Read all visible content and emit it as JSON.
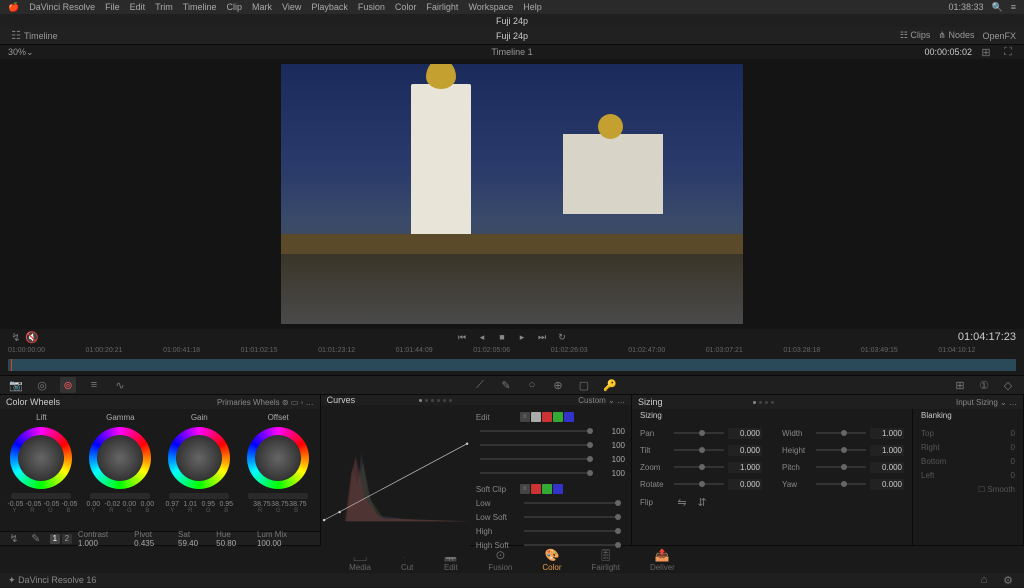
{
  "menubar": {
    "app": "DaVinci Resolve",
    "items": [
      "File",
      "Edit",
      "Trim",
      "Timeline",
      "Clip",
      "Mark",
      "View",
      "Playback",
      "Fusion",
      "Color",
      "Fairlight",
      "Workspace",
      "Help"
    ],
    "clock": "01:38:33"
  },
  "titlebar": {
    "title": "Fuji 24p"
  },
  "toolbar": {
    "left": "Timeline",
    "center": "Fuji 24p",
    "clips": "Clips",
    "nodes": "Nodes",
    "openfx": "OpenFX"
  },
  "subbar": {
    "zoom": "30%",
    "timeline": "Timeline 1",
    "timecode": "00:00:05:02"
  },
  "transport": {
    "left_tc": "",
    "right_tc": "01:04:17:23"
  },
  "timeline": {
    "marks": [
      "01:00:00:00",
      "01:00:20:21",
      "01:00:41:18",
      "01:01:02:15",
      "01:01:23:12",
      "01:01:44:09",
      "01:02:05:06",
      "01:02:26:03",
      "01:02:47:00",
      "01:03:07:21",
      "01:03:28:18",
      "01:03:49:15",
      "01:04:10:12"
    ],
    "end_tc": "01:04:17:23"
  },
  "wheels": {
    "title": "Color Wheels",
    "mode": "Primaries Wheels",
    "cols": [
      {
        "name": "Lift",
        "vals": [
          "-0.05",
          "-0.05",
          "-0.05",
          "-0.05"
        ],
        "sub": [
          "Y",
          "R",
          "G",
          "B"
        ]
      },
      {
        "name": "Gamma",
        "vals": [
          "0.00",
          "-0.02",
          "0.00",
          "0.00"
        ],
        "sub": [
          "Y",
          "R",
          "G",
          "B"
        ]
      },
      {
        "name": "Gain",
        "vals": [
          "0.97",
          "1.01",
          "0.95",
          "0.95"
        ],
        "sub": [
          "Y",
          "R",
          "G",
          "B"
        ]
      },
      {
        "name": "Offset",
        "vals": [
          "38.75",
          "38.75",
          "38.75"
        ],
        "sub": [
          "R",
          "G",
          "B"
        ]
      }
    ],
    "pages": [
      "1",
      "2"
    ],
    "params": {
      "contrast": "1.000",
      "pivot": "0.435",
      "sat": "59.40",
      "hue": "50.80",
      "lummix": "100.00"
    },
    "param_labels": {
      "contrast": "Contrast",
      "pivot": "Pivot",
      "sat": "Sat",
      "hue": "Hue",
      "lummix": "Lum Mix"
    }
  },
  "curves": {
    "title": "Curves",
    "mode": "Custom",
    "edit_lbl": "Edit",
    "spline_vals": [
      "100",
      "100",
      "100",
      "100"
    ],
    "softclip_lbl": "Soft Clip",
    "low": "Low",
    "lowsoft": "Low Soft",
    "high": "High",
    "highsoft": "High Soft"
  },
  "sizing": {
    "title": "Sizing",
    "mode": "Input Sizing",
    "sub": "Sizing",
    "blanking": "Blanking",
    "left": [
      {
        "lbl": "Pan",
        "v": "0.000"
      },
      {
        "lbl": "Tilt",
        "v": "0.000"
      },
      {
        "lbl": "Zoom",
        "v": "1.000"
      },
      {
        "lbl": "Rotate",
        "v": "0.000"
      }
    ],
    "right": [
      {
        "lbl": "Width",
        "v": "1.000"
      },
      {
        "lbl": "Height",
        "v": "1.000"
      },
      {
        "lbl": "Pitch",
        "v": "0.000"
      },
      {
        "lbl": "Yaw",
        "v": "0.000"
      }
    ],
    "flip": "Flip",
    "blank": [
      {
        "lbl": "Top",
        "v": "0"
      },
      {
        "lbl": "Right",
        "v": "0"
      },
      {
        "lbl": "Bottom",
        "v": "0"
      },
      {
        "lbl": "Left",
        "v": "0"
      }
    ],
    "smooth": "Smooth"
  },
  "pages": {
    "items": [
      "Media",
      "Cut",
      "Edit",
      "Fusion",
      "Color",
      "Fairlight",
      "Deliver"
    ],
    "active": 4
  },
  "footer": {
    "brand": "DaVinci Resolve 16"
  }
}
